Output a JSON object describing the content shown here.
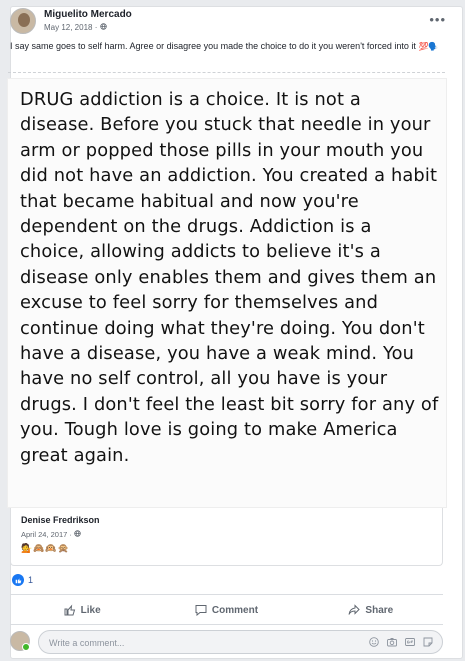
{
  "post": {
    "author": "Miguelito Mercado",
    "date": "May 12, 2018 · ",
    "audience_icon": "globe-icon",
    "menu_icon": "more-icon",
    "text": "I say same goes to self harm. Agree or disagree you made the choice to do it you weren't forced into it ",
    "text_emojis": "💯🗣️"
  },
  "shared_image": {
    "text": "DRUG addiction is a choice. It is not a disease. Before you stuck that needle in your arm or popped those pills in your mouth you did not have an addiction. You created a habit that became habitual and now you're dependent on the drugs. Addiction is a choice, allowing addicts to believe it's a disease only enables them and gives them an excuse to feel sorry for themselves and continue doing what they're doing. You don't have a disease, you have a weak mind. You have no self control, all you have is your drugs. I don't feel the least bit sorry for any of you. Tough love is going to make America great again."
  },
  "shared_post": {
    "author": "Denise Fredrikson",
    "date": "April 24, 2017 · ",
    "emojis": "💁🙈🙉🙊"
  },
  "reactions": {
    "icon": "like-reaction-icon",
    "count": "1"
  },
  "actions": {
    "like": "Like",
    "comment": "Comment",
    "share": "Share"
  },
  "comment_box": {
    "placeholder": "Write a comment...",
    "icons": [
      "emoji-icon",
      "camera-icon",
      "gif-icon",
      "sticker-icon"
    ]
  },
  "colors": {
    "link_blue": "#385898",
    "like_blue": "#1877f2",
    "secondary_text": "#606770",
    "background": "#e9ebee"
  }
}
